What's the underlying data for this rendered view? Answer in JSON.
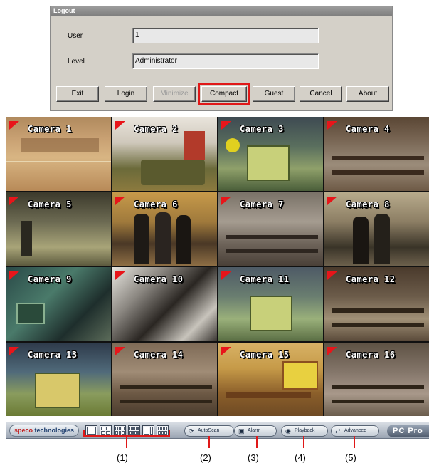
{
  "dialog": {
    "title": "Logout",
    "user_label": "User",
    "user_value": "1",
    "level_label": "Level",
    "level_value": "Administrator",
    "buttons": {
      "exit": "Exit",
      "login": "Login",
      "minimize": "Minimize",
      "compact": "Compact",
      "guest": "Guest",
      "cancel": "Cancel",
      "about": "About"
    }
  },
  "cameras": [
    {
      "label": "Camera 1"
    },
    {
      "label": "Camera 2"
    },
    {
      "label": "Camera 3"
    },
    {
      "label": "Camera 4"
    },
    {
      "label": "Camera 5"
    },
    {
      "label": "Camera 6"
    },
    {
      "label": "Camera 7"
    },
    {
      "label": "Camera 8"
    },
    {
      "label": "Camera 9"
    },
    {
      "label": "Camera 10"
    },
    {
      "label": "Camera 11"
    },
    {
      "label": "Camera 12"
    },
    {
      "label": "Camera 13"
    },
    {
      "label": "Camera 14"
    },
    {
      "label": "Camera 15"
    },
    {
      "label": "Camera 16"
    }
  ],
  "toolbar": {
    "logo_part1": "speco",
    "logo_part2": " technologies",
    "autoscan": "AutoScan",
    "alarm": "Alarm",
    "playback": "Playback",
    "advanced": "Advanced",
    "product": "PC Pro"
  },
  "callouts": [
    "(1)",
    "(2)",
    "(3)",
    "(4)",
    "(5)"
  ],
  "colors": {
    "highlight": "#e01818",
    "camera_flag": "#e8151a"
  }
}
